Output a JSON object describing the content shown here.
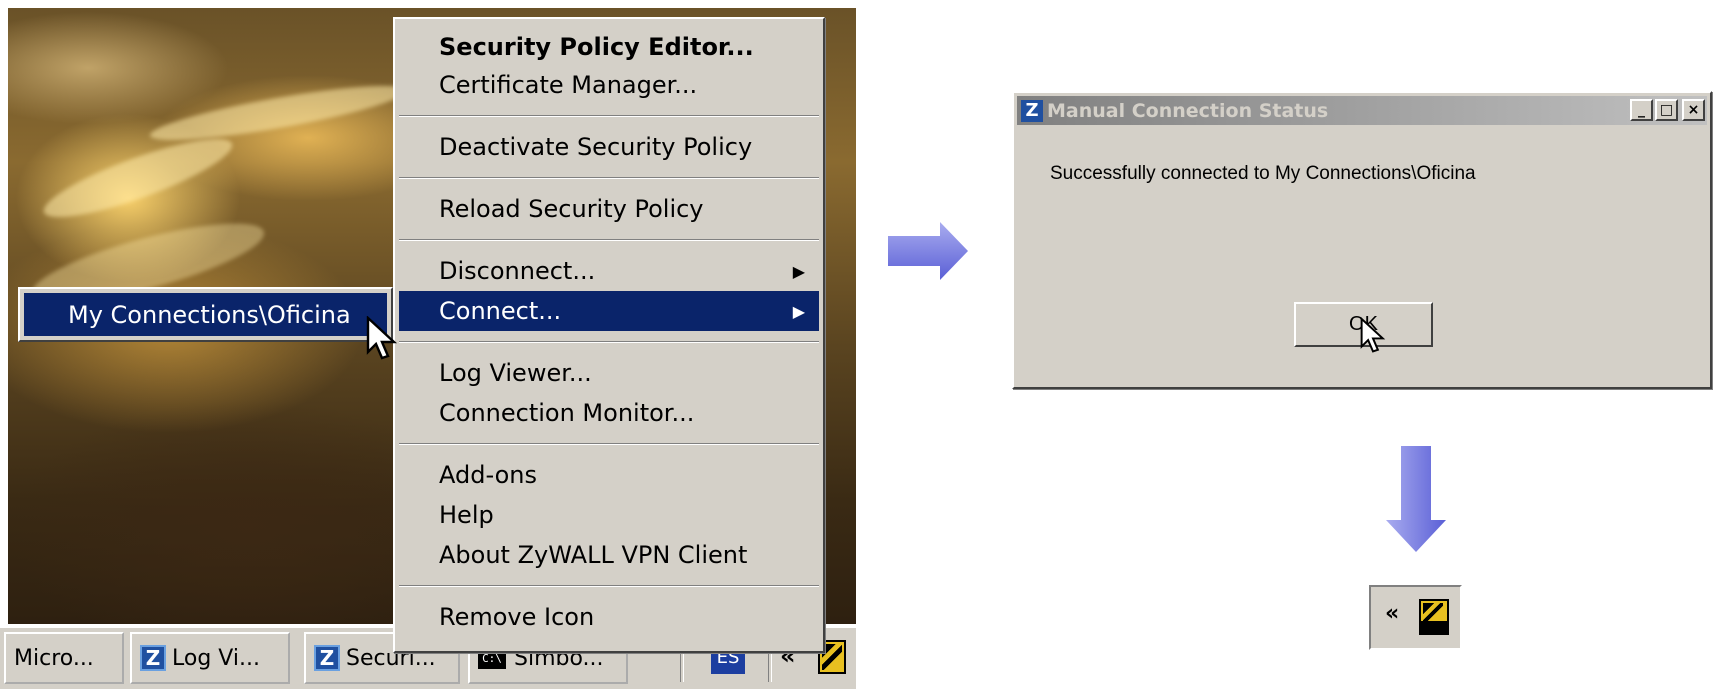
{
  "context_menu": {
    "items": [
      {
        "label": "Security Policy Editor...",
        "bold": true
      },
      {
        "label": "Certificate Manager..."
      },
      {
        "label": "Deactivate Security Policy"
      },
      {
        "label": "Reload Security Policy"
      },
      {
        "label": "Disconnect...",
        "submenu": true
      },
      {
        "label": "Connect...",
        "submenu": true,
        "selected": true
      },
      {
        "label": "Log Viewer..."
      },
      {
        "label": "Connection Monitor..."
      },
      {
        "label": "Add-ons"
      },
      {
        "label": "Help"
      },
      {
        "label": "About ZyWALL VPN Client"
      },
      {
        "label": "Remove Icon"
      }
    ],
    "submenu_arrow": "▶"
  },
  "submenu": {
    "item_label": "My Connections\\Oficina"
  },
  "taskbar": {
    "buttons": [
      {
        "label": "Micro..."
      },
      {
        "label": "Log Vi..."
      },
      {
        "label": "Securi..."
      },
      {
        "label": "Simbo..."
      }
    ],
    "language_indicator": "ES",
    "tray_chevron": "«"
  },
  "dialog": {
    "title": "Manual Connection Status",
    "title_icon": "Z",
    "message": "Successfully connected to My Connections\\Oficina",
    "ok_label": "OK",
    "minimize_label": "_",
    "maximize_label": "□",
    "close_label": "×"
  },
  "tray_result": {
    "chevron": "«"
  },
  "colors": {
    "menu_selection": "#0a246a",
    "flow_arrow": "#7b7ee0",
    "window_face": "#d4d0c8"
  },
  "icons": [
    "zywall-z-icon",
    "cmd-icon",
    "vpn-tray-icon",
    "mouse-cursor-icon",
    "flow-arrow-right-icon",
    "flow-arrow-down-icon"
  ]
}
